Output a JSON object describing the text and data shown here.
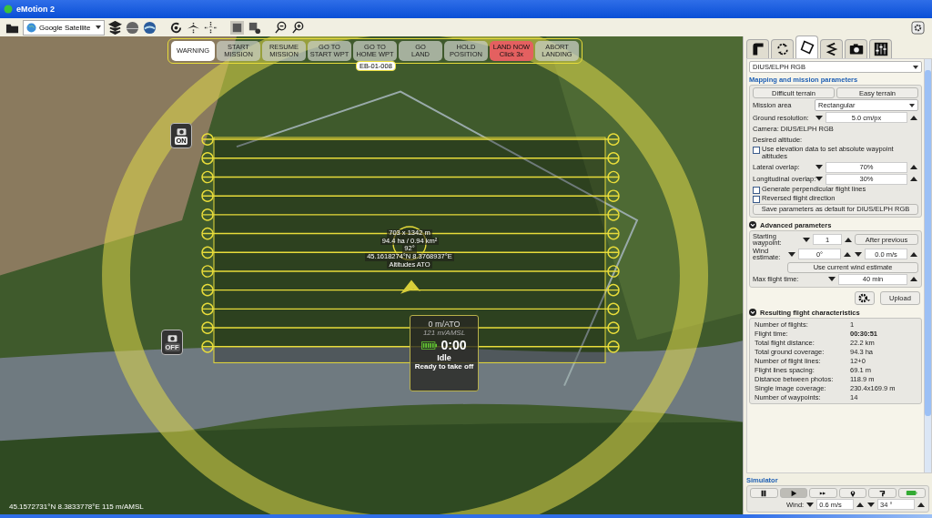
{
  "window": {
    "title": "eMotion 2"
  },
  "toolbar": {
    "map_source": "Google Satellite"
  },
  "map": {
    "action_buttons": [
      {
        "lines": [
          "WARNING"
        ],
        "kind": "warning"
      },
      {
        "lines": [
          "START",
          "MISSION"
        ],
        "kind": "normal"
      },
      {
        "lines": [
          "RESUME",
          "MISSION"
        ],
        "kind": "normal"
      },
      {
        "lines": [
          "GO TO",
          "START WPT"
        ],
        "kind": "normal"
      },
      {
        "lines": [
          "GO TO",
          "HOME WPT"
        ],
        "kind": "normal"
      },
      {
        "lines": [
          "GO",
          "LAND"
        ],
        "kind": "normal"
      },
      {
        "lines": [
          "HOLD",
          "POSITION"
        ],
        "kind": "normal"
      },
      {
        "lines": [
          "LAND NOW",
          "Click 3x"
        ],
        "kind": "danger"
      },
      {
        "lines": [
          "ABORT",
          "LANDING"
        ],
        "kind": "normal"
      }
    ],
    "drone_id": "EB-01-008",
    "camera_triggers": [
      {
        "label": "ON",
        "on": true
      },
      {
        "label": "OFF",
        "on": false
      }
    ],
    "area_info": [
      "703 x 1342 m",
      "94.4 ha / 0.94 km²",
      "92°",
      "45.1618274°N 8.3768937°E",
      "Altitudes ATO"
    ],
    "status": {
      "altitude_ato": "0 m/ATO",
      "altitude_amsl": "121 m/AMSL",
      "timer": "0:00",
      "state": "Idle",
      "message": "Ready to take off"
    },
    "coordinates": "45.1572731°N 8.3833778°E 115 m/AMSL"
  },
  "panel": {
    "tabs": [
      {
        "kind": "wing",
        "selected": false
      },
      {
        "kind": "cycle",
        "selected": false
      },
      {
        "kind": "area",
        "selected": true
      },
      {
        "kind": "path",
        "selected": false
      },
      {
        "kind": "camera",
        "selected": false
      },
      {
        "kind": "sliders",
        "selected": false
      }
    ],
    "camera_select": "DIUS/ELPH RGB",
    "mapping": {
      "title": "Mapping and mission parameters",
      "rows": [
        {
          "kind": "buttons",
          "buttons": [
            "Difficult terrain",
            "Easy terrain"
          ]
        },
        {
          "kind": "select",
          "label": "Mission area",
          "value": "Rectangular"
        },
        {
          "kind": "spin",
          "label": "Ground resolution:",
          "value": "5.0 cm/px"
        },
        {
          "kind": "text",
          "text": "Camera: DIUS/ELPH RGB"
        },
        {
          "kind": "text",
          "text": "Desired altitude:"
        },
        {
          "kind": "checkbox",
          "label": "Use elevation data to set absolute waypoint altitudes",
          "checked": false
        },
        {
          "kind": "spin",
          "label": "Lateral overlap:",
          "value": "70%"
        },
        {
          "kind": "spin",
          "label": "Longitudinal overlap:",
          "value": "30%"
        },
        {
          "kind": "checkbox",
          "label": "Generate perpendicular flight lines",
          "checked": false
        },
        {
          "kind": "checkbox",
          "label": "Reversed flight direction",
          "checked": false
        },
        {
          "kind": "button",
          "label": "Save parameters as default for DIUS/ELPH RGB"
        }
      ]
    },
    "advanced": {
      "title": "Advanced parameters",
      "expanded": true,
      "starting_waypoint": {
        "label": "Starting waypoint:",
        "value": "1",
        "button": "After previous"
      },
      "wind": {
        "label": "Wind estimate:",
        "direction": "0°",
        "speed": "0.0 m/s",
        "button": "Use current wind estimate"
      },
      "max_flight_time": {
        "label": "Max flight time:",
        "value": "40 min"
      }
    },
    "upload_button": "Upload",
    "results": {
      "title": "Resulting flight characteristics",
      "expanded": true,
      "rows": [
        {
          "label": "Number of flights:",
          "value": "1",
          "bold": false
        },
        {
          "label": "Flight time:",
          "value": "00:30:51",
          "bold": true
        },
        {
          "label": "Total flight distance:",
          "value": "22.2 km",
          "bold": false
        },
        {
          "label": "Total ground coverage:",
          "value": "94.3 ha",
          "bold": false
        },
        {
          "label": "Number of flight lines:",
          "value": "12+0",
          "bold": false
        },
        {
          "label": "Flight lines spacing:",
          "value": "69.1 m",
          "bold": false
        },
        {
          "label": "Distance between photos:",
          "value": "118.9 m",
          "bold": false
        },
        {
          "label": "Single image coverage:",
          "value": "230.4x169.9 m",
          "bold": false
        },
        {
          "label": "Number of waypoints:",
          "value": "14",
          "bold": false
        }
      ]
    },
    "simulator": {
      "title": "Simulator",
      "buttons": [
        {
          "kind": "pause",
          "selected": false
        },
        {
          "kind": "play",
          "selected": true
        },
        {
          "kind": "fast-forward",
          "selected": false
        },
        {
          "kind": "pin",
          "selected": false
        },
        {
          "kind": "launch",
          "selected": false
        },
        {
          "kind": "battery",
          "selected": false
        }
      ],
      "wind_label": "Wind:",
      "wind_speed": "0.6 m/s",
      "wind_direction": "34 °"
    }
  }
}
